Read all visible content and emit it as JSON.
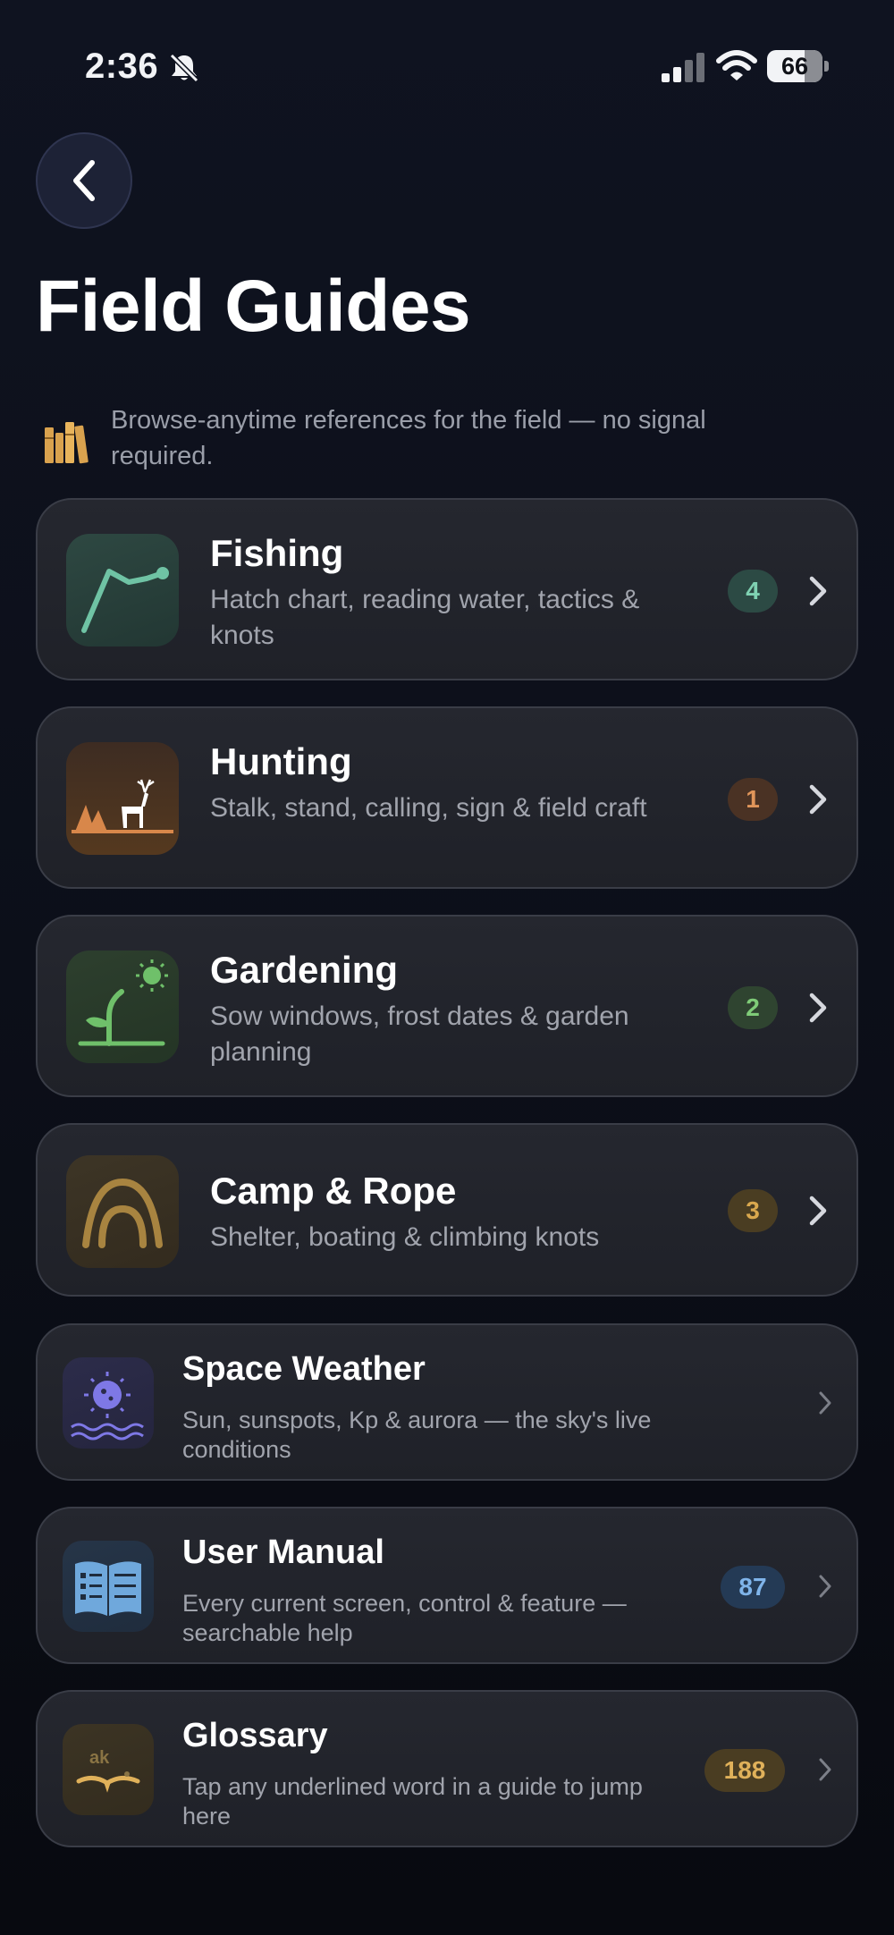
{
  "status_bar": {
    "time": "2:36",
    "battery": "66"
  },
  "header": {
    "title": "Field Guides"
  },
  "intro": {
    "text": "Browse-anytime references for the field — no signal required."
  },
  "guides": [
    {
      "title": "Fishing",
      "description": "Hatch chart, reading water, tactics & knots",
      "badge": "4"
    },
    {
      "title": "Hunting",
      "description": "Stalk, stand, calling, sign & field craft",
      "badge": "1"
    },
    {
      "title": "Gardening",
      "description": "Sow windows, frost dates & garden planning",
      "badge": "2"
    },
    {
      "title": "Camp & Rope",
      "description": "Shelter, boating & climbing knots",
      "badge": "3"
    },
    {
      "title": "Space Weather",
      "description": "Sun, sunspots, Kp & aurora — the sky's live conditions"
    },
    {
      "title": "User Manual",
      "description": "Every current screen, control & feature — searchable help",
      "badge": "87"
    },
    {
      "title": "Glossary",
      "description": "Tap any underlined word in a guide to jump here",
      "badge": "188",
      "icon_text": "ak"
    }
  ],
  "colors": {
    "fishing_accent": "#6fc3a4",
    "hunting_accent": "#d8874a",
    "gardening_accent": "#6fc06a",
    "camp_accent": "#c99a45",
    "space_accent": "#7e78e6",
    "manual_accent": "#6fa8dc",
    "glossary_accent": "#e0b15a"
  },
  "icons": [
    "back-chevron-icon",
    "bell-slash-icon",
    "signal-icon",
    "wifi-icon",
    "battery-icon",
    "books-icon",
    "chevron-right-icon"
  ]
}
